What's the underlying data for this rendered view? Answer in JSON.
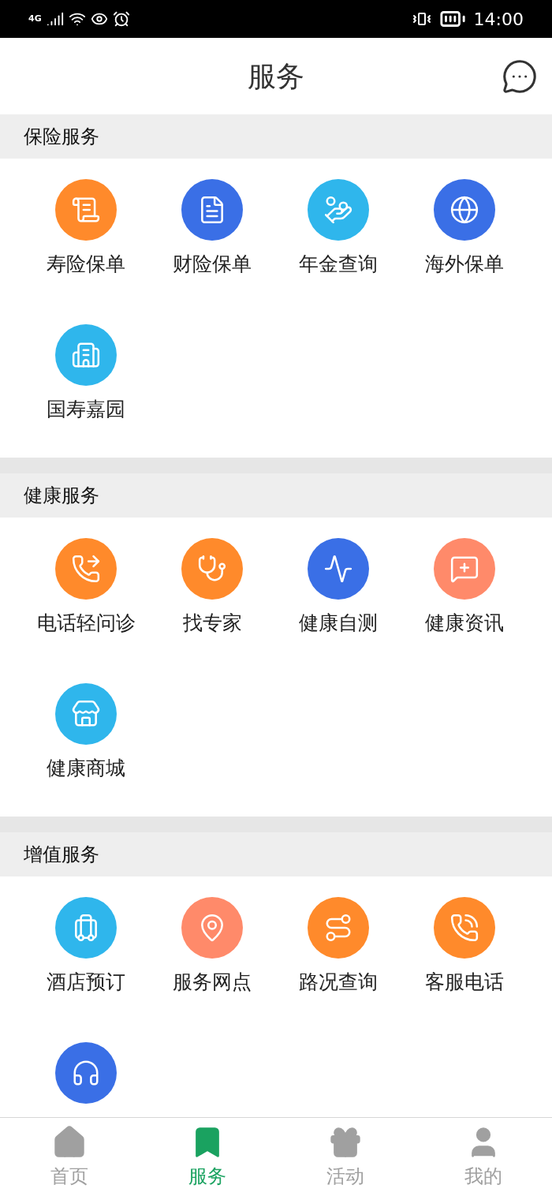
{
  "status_bar": {
    "network": "4G",
    "time": "14:00"
  },
  "header": {
    "title": "服务"
  },
  "sections": [
    {
      "title": "保险服务",
      "items": [
        {
          "label": "寿险保单",
          "color": "#ff8a2b"
        },
        {
          "label": "财险保单",
          "color": "#3a6fe6"
        },
        {
          "label": "年金查询",
          "color": "#2fb6ec"
        },
        {
          "label": "海外保单",
          "color": "#3a6fe6"
        },
        {
          "label": "国寿嘉园",
          "color": "#2fb6ec"
        }
      ]
    },
    {
      "title": "健康服务",
      "items": [
        {
          "label": "电话轻问诊",
          "color": "#ff8a2b"
        },
        {
          "label": "找专家",
          "color": "#ff8a2b"
        },
        {
          "label": "健康自测",
          "color": "#3a6fe6"
        },
        {
          "label": "健康资讯",
          "color": "#ff8a6a"
        },
        {
          "label": "健康商城",
          "color": "#2fb6ec"
        }
      ]
    },
    {
      "title": "增值服务",
      "items": [
        {
          "label": "酒店预订",
          "color": "#2fb6ec"
        },
        {
          "label": "服务网点",
          "color": "#ff8a6a"
        },
        {
          "label": "路况查询",
          "color": "#ff8a2b"
        },
        {
          "label": "客服电话",
          "color": "#ff8a2b"
        },
        {
          "color": "#3a6fe6"
        }
      ]
    }
  ],
  "tabs": [
    {
      "label": "首页",
      "selected": false
    },
    {
      "label": "服务",
      "selected": true
    },
    {
      "label": "活动",
      "selected": false
    },
    {
      "label": "我的",
      "selected": false
    }
  ]
}
